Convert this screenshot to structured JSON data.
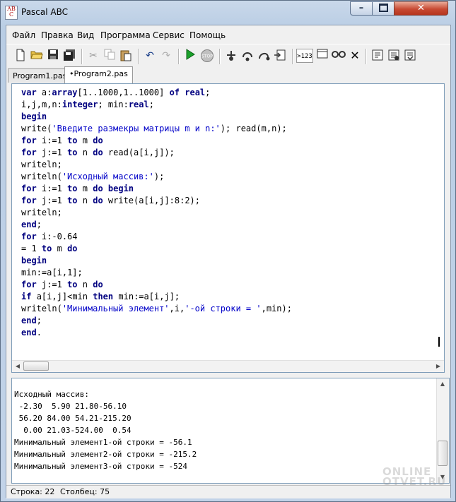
{
  "window": {
    "title": "Pascal ABC",
    "icon_text": "AB C",
    "controls": {
      "minimize": "–",
      "close": "✕"
    }
  },
  "menu": [
    "Файл",
    "Правка",
    "Вид",
    "Программа",
    "Сервис",
    "Помощь"
  ],
  "toolbar": {
    "items": [
      "new-file-icon",
      "open-folder-icon",
      "save-icon",
      "save-all-icon",
      "cut-icon",
      "copy-icon",
      "paste-icon",
      "undo-icon",
      "redo-icon",
      "run-icon",
      "stop-icon",
      "step-into-icon",
      "step-over-icon",
      "step-out-icon",
      "debug-window-icon",
      "watch-icon",
      "locals-icon",
      "glasses-icon",
      "cancel-icon",
      "build-icon",
      "build-all-icon",
      "rebuild-icon"
    ],
    "watch_label": ">123",
    "stop_label": "STOP"
  },
  "tabs": [
    {
      "label": "Program1.pas",
      "active": false
    },
    {
      "label": "•Program2.pas",
      "active": true
    }
  ],
  "editor": {
    "lines": [
      "var a:array[1..1000,1..1000] of real;",
      "i,j,m,n:integer; min:real;",
      "begin",
      "write('Введите размекры матрицы m и n:'); read(m,n);",
      "for i:=1 to m do",
      "for j:=1 to n do read(a[i,j]);",
      "writeln;",
      "writeln('Исходный массив:');",
      "for i:=1 to m do begin",
      "for j:=1 to n do write(a[i,j]:8:2);",
      "writeln;",
      "end;",
      "for i:-0.64",
      "= 1 to m do",
      "begin",
      "min:=a[i,1];",
      "for j:=1 to n do",
      "if a[i,j]<min then min:=a[i,j];",
      "writeln('Минимальный элемент',i,'-ой строки = ',min);",
      "end;",
      "end."
    ]
  },
  "output": {
    "lines": [
      "Исходный массив:",
      " -2.30  5.90 21.80-56.10",
      " 56.20 84.00 54.21-215.20",
      "  0.00 21.03-524.00  0.54",
      "Минимальный элемент1-ой строки = -56.1",
      "Минимальный элемент2-ой строки = -215.2",
      "Минимальный элемент3-ой строки = -524"
    ]
  },
  "status": {
    "line": "Строка: 22",
    "column": "Столбец: 75"
  },
  "watermark": {
    "line1": "ONLINE",
    "line2": "OTVET.RU"
  }
}
